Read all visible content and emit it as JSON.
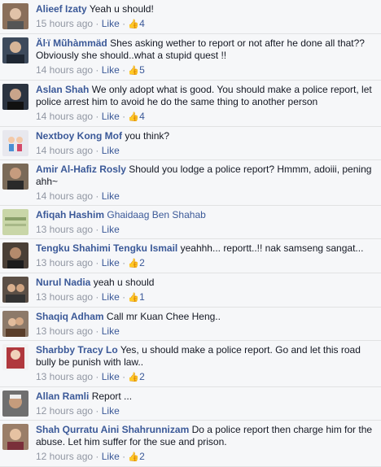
{
  "meta_sep": " · ",
  "comments": [
    {
      "author": "Alieef Izaty",
      "text": "Yeah u should!",
      "time": "15 hours ago",
      "like_label": "Like",
      "likes": "4",
      "avatar_color": "#8a6f5a"
    },
    {
      "author": "Äŀï Mũhàmmäd",
      "text": "Shes asking wether to report or not after he done all that?? Obviously she should..what a stupid quest !!",
      "time": "14 hours ago",
      "like_label": "Like",
      "likes": "5",
      "avatar_color": "#3d4a5c"
    },
    {
      "author": "Aslan Shah",
      "text": "We only adopt what is good. You should make a police report, let police arrest him to avoid he do the same thing to another person",
      "time": "14 hours ago",
      "like_label": "Like",
      "likes": "4",
      "avatar_color": "#2b3340"
    },
    {
      "author": "Nextboy Kong Mof",
      "text": "you think?",
      "time": "14 hours ago",
      "like_label": "Like",
      "likes": "",
      "avatar_color": "#e8e8ee"
    },
    {
      "author": "Amir Al-Hafiz Rosly",
      "text": "Should you lodge a police report? Hmmm, adoiii, pening ahh~",
      "time": "14 hours ago",
      "like_label": "Like",
      "likes": "",
      "avatar_color": "#7a6a58"
    },
    {
      "author": "Afiqah Hashim",
      "tag": "Ghaidaag Ben Shahab",
      "text": "",
      "time": "13 hours ago",
      "like_label": "Like",
      "likes": "",
      "avatar_color": "#c9d6a8"
    },
    {
      "author": "Tengku Shahimi Tengku Ismail",
      "text": "yeahhh... reportt..!! nak samseng sangat...",
      "time": "13 hours ago",
      "like_label": "Like",
      "likes": "2",
      "avatar_color": "#4a3f36"
    },
    {
      "author": "Nurul Nadia",
      "text": "yeah u should",
      "time": "13 hours ago",
      "like_label": "Like",
      "likes": "1",
      "avatar_color": "#5b4f46"
    },
    {
      "author": "Shaqiq Adham",
      "text": "Call mr Kuan Chee Heng..",
      "time": "13 hours ago",
      "like_label": "Like",
      "likes": "",
      "avatar_color": "#8d7a6a"
    },
    {
      "author": "Sharbby Tracy Lo",
      "text": "Yes, u should make a police report. Go and let this road bully be punish with law..",
      "time": "13 hours ago",
      "like_label": "Like",
      "likes": "2",
      "avatar_color": "#b0383d"
    },
    {
      "author": "Allan Ramli",
      "text": "Report ...",
      "time": "12 hours ago",
      "like_label": "Like",
      "likes": "",
      "avatar_color": "#6f6f6f"
    },
    {
      "author": "Shah Qurratu Aini Shahrunnizam",
      "text": "Do a police report then charge him for the abuse. Let him suffer for the sue and prison.",
      "time": "12 hours ago",
      "like_label": "Like",
      "likes": "2",
      "avatar_color": "#9a7e68"
    }
  ]
}
